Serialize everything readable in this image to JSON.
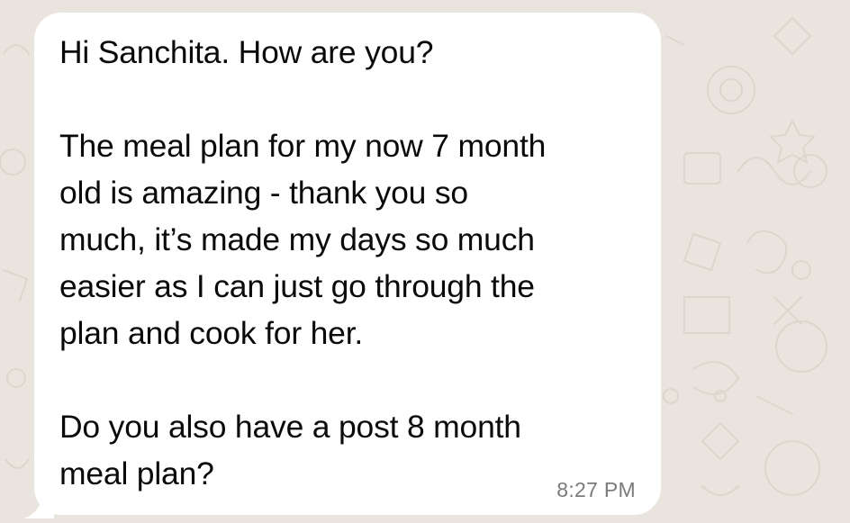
{
  "message": {
    "greeting": "Hi Sanchita. How are you?",
    "paragraph2": [
      "The meal plan for my now 7 month",
      "old is amazing - thank you so",
      "much, it’s made my days so much",
      "easier as I can just go through the",
      "plan and cook for her."
    ],
    "paragraph3": [
      "Do you also have a post 8 month",
      "meal plan?"
    ],
    "time": "8:27 PM"
  },
  "colors": {
    "wallpaper": "#e9e4dd",
    "bubble": "#ffffff",
    "text": "#0a0a0a",
    "timestamp": "#7a7a7a"
  }
}
